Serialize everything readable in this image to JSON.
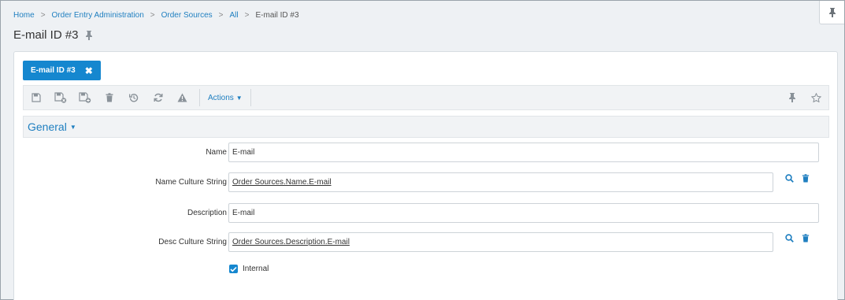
{
  "breadcrumb": {
    "home": "Home",
    "order_entry": "Order Entry Administration",
    "order_sources": "Order Sources",
    "all": "All",
    "current": "E-mail ID #3"
  },
  "page_title": "E-mail ID #3",
  "tab": {
    "label": "E-mail ID #3"
  },
  "toolbar": {
    "actions_label": "Actions"
  },
  "section": {
    "title": "General"
  },
  "form": {
    "name": {
      "label": "Name",
      "value": "E-mail"
    },
    "name_culture": {
      "label": "Name Culture String",
      "value": "Order Sources.Name.E-mail"
    },
    "description": {
      "label": "Description",
      "value": "E-mail"
    },
    "desc_culture": {
      "label": "Desc Culture String",
      "value": "Order Sources.Description.E-mail"
    },
    "internal": {
      "label": "Internal",
      "checked": true
    }
  },
  "colors": {
    "accent": "#1587cf",
    "link": "#1f7fc0",
    "background": "#eef1f4",
    "icon_gray": "#8a9299"
  }
}
